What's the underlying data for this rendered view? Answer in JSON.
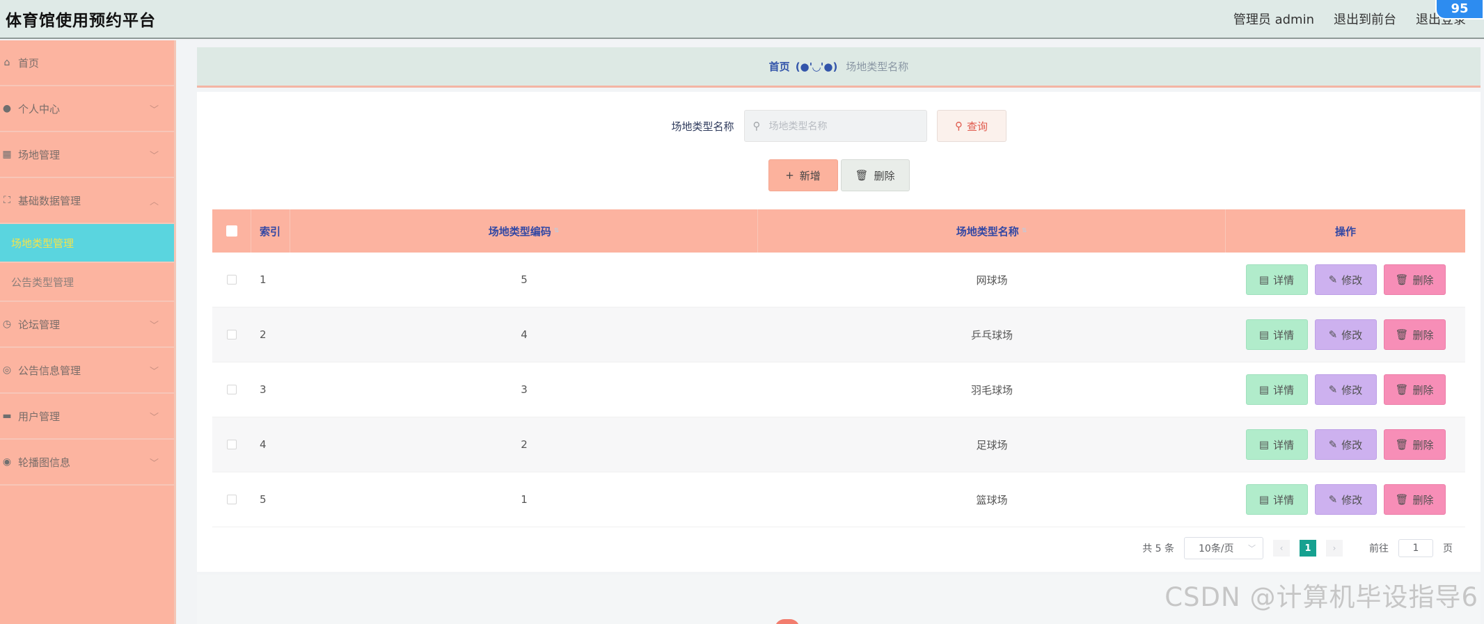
{
  "app": {
    "title": "体育馆使用预约平台"
  },
  "header": {
    "user_label": "管理员 admin",
    "to_front": "退出到前台",
    "logout": "退出登录",
    "badge": "95"
  },
  "sidebar": {
    "items": [
      {
        "label": "首页",
        "icon": "home-icon",
        "expandable": false
      },
      {
        "label": "个人中心",
        "icon": "user-icon",
        "expandable": true
      },
      {
        "label": "场地管理",
        "icon": "calendar-icon",
        "expandable": true
      },
      {
        "label": "基础数据管理",
        "icon": "expand-icon",
        "expandable": true,
        "expanded": true,
        "children": [
          {
            "label": "场地类型管理",
            "active": true
          },
          {
            "label": "公告类型管理",
            "active": false
          }
        ]
      },
      {
        "label": "论坛管理",
        "icon": "clock-icon",
        "expandable": true
      },
      {
        "label": "公告信息管理",
        "icon": "compass-icon",
        "expandable": true
      },
      {
        "label": "用户管理",
        "icon": "briefcase-icon",
        "expandable": true
      },
      {
        "label": "轮播图信息",
        "icon": "location-icon",
        "expandable": true
      }
    ]
  },
  "breadcrumb": {
    "home": "首页",
    "emoticon": "(●'◡'●)",
    "current": "场地类型名称"
  },
  "search": {
    "label": "场地类型名称",
    "placeholder": "场地类型名称",
    "query_button": "查询"
  },
  "actions": {
    "add": "新增",
    "delete": "删除"
  },
  "table": {
    "headers": {
      "index": "索引",
      "code": "场地类型编码",
      "name": "场地类型名称",
      "ops": "操作"
    },
    "rows": [
      {
        "index": "1",
        "code": "5",
        "name": "网球场"
      },
      {
        "index": "2",
        "code": "4",
        "name": "乒乓球场"
      },
      {
        "index": "3",
        "code": "3",
        "name": "羽毛球场"
      },
      {
        "index": "4",
        "code": "2",
        "name": "足球场"
      },
      {
        "index": "5",
        "code": "1",
        "name": "篮球场"
      }
    ],
    "op_labels": {
      "detail": "详情",
      "edit": "修改",
      "delete": "删除"
    }
  },
  "pagination": {
    "total": "共 5 条",
    "page_size": "10条/页",
    "current_page": "1",
    "goto_label": "前往",
    "goto_value": "1",
    "page_unit": "页"
  },
  "watermark": "CSDN @计算机毕设指导6",
  "colors": {
    "sidebar_bg": "#fcb4a0",
    "active_menu": "#5ad5df",
    "table_header": "#fcb3a0",
    "detail_btn": "#b1eccb",
    "edit_btn": "#cdb1ef",
    "delete_btn": "#f78eb7",
    "pager_active": "#16a190"
  }
}
